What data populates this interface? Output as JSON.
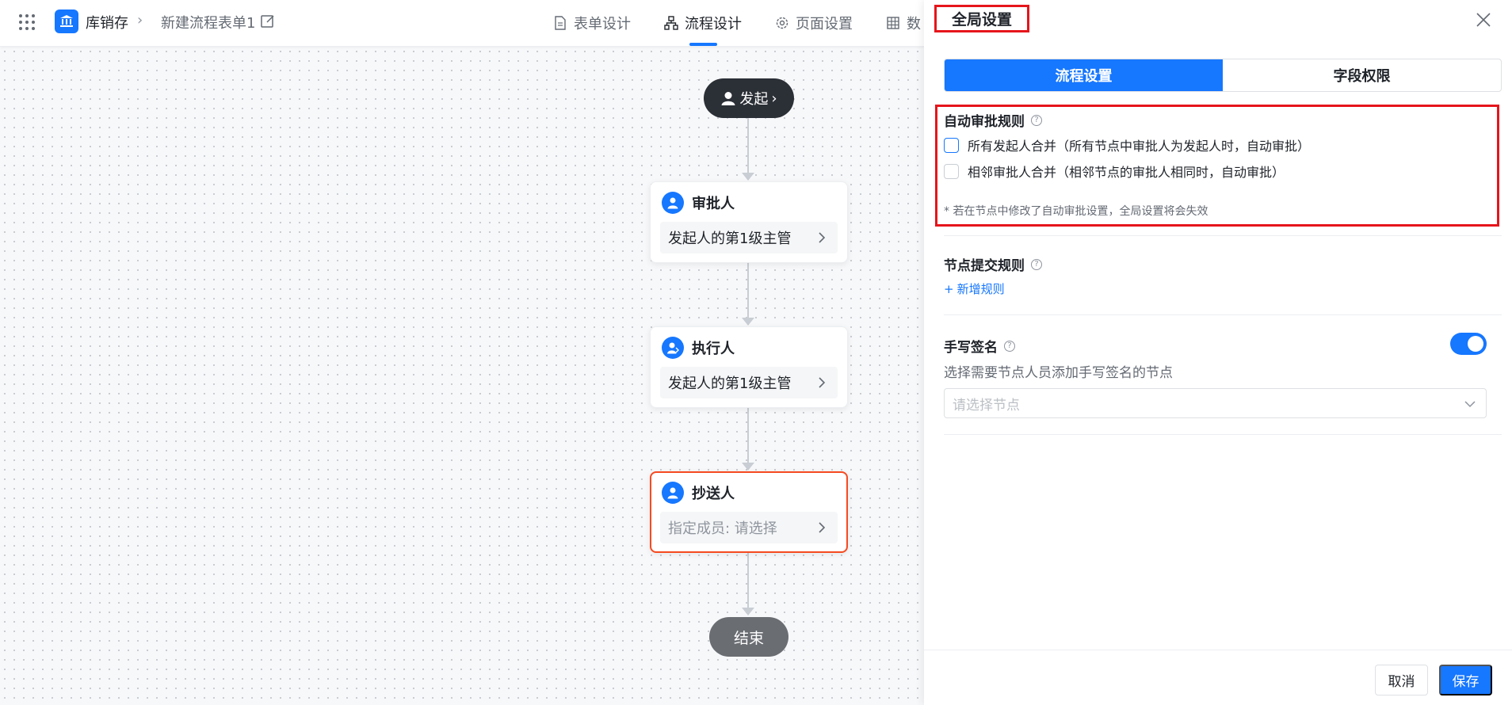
{
  "header": {
    "app_name": "库销存",
    "form_name": "新建流程表单1",
    "tabs": [
      {
        "label": "表单设计",
        "icon": "document-icon"
      },
      {
        "label": "流程设计",
        "icon": "flow-icon",
        "active": true
      },
      {
        "label": "页面设置",
        "icon": "gear-icon"
      },
      {
        "label": "数",
        "icon": "table-icon"
      }
    ]
  },
  "flow": {
    "start_label": "发起",
    "end_label": "结束",
    "nodes": [
      {
        "title": "审批人",
        "value": "发起人的第1级主管"
      },
      {
        "title": "执行人",
        "value": "发起人的第1级主管"
      },
      {
        "title": "抄送人",
        "value": "指定成员: 请选择",
        "placeholder": true,
        "selected": true
      }
    ]
  },
  "panel": {
    "title": "全局设置",
    "segments": [
      "流程设置",
      "字段权限"
    ],
    "auto_approve": {
      "title": "自动审批规则",
      "options": [
        "所有发起人合并（所有节点中审批人为发起人时，自动审批）",
        "相邻审批人合并（相邻节点的审批人相同时，自动审批）"
      ],
      "note": "* 若在节点中修改了自动审批设置，全局设置将会失效"
    },
    "submit_rules": {
      "title": "节点提交规则",
      "add_label": "新增规则"
    },
    "signature": {
      "title": "手写签名",
      "enabled": true,
      "description": "选择需要节点人员添加手写签名的节点",
      "select_placeholder": "请选择节点"
    },
    "footer": {
      "cancel": "取消",
      "save": "保存"
    }
  },
  "colors": {
    "accent": "#1677ff",
    "highlight_red": "#e6151b",
    "selected_node": "#f54a20"
  }
}
